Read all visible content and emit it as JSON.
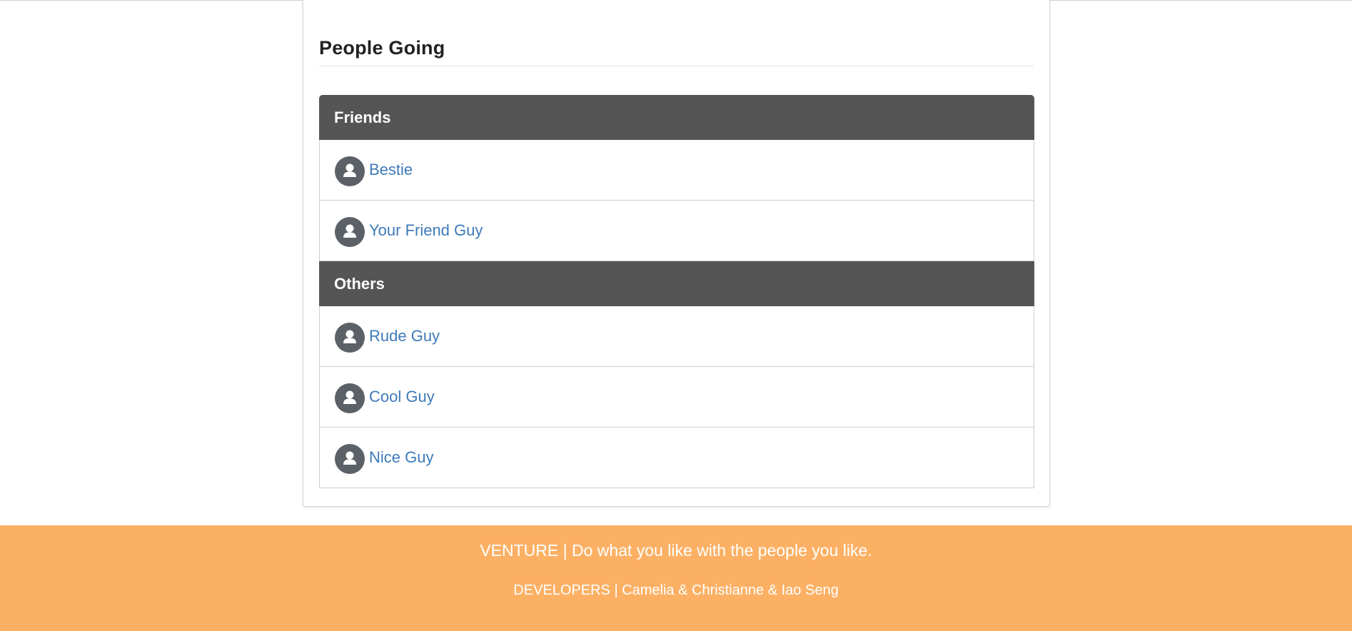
{
  "section": {
    "title": "People Going"
  },
  "groups": [
    {
      "label": "Friends",
      "people": [
        {
          "name": "Bestie"
        },
        {
          "name": "Your Friend Guy"
        }
      ]
    },
    {
      "label": "Others",
      "people": [
        {
          "name": "Rude Guy"
        },
        {
          "name": "Cool Guy"
        },
        {
          "name": "Nice Guy"
        }
      ]
    }
  ],
  "footer": {
    "tagline": "VENTURE | Do what you like with the people you like.",
    "developers": "DEVELOPERS | Camelia & Christianne & Iao Seng"
  },
  "colors": {
    "group_header_bg": "#555555",
    "link": "#3d7ab8",
    "footer_bg": "#fcb064",
    "avatar_bg": "#5b6167"
  },
  "icons": {
    "avatar": "user-silhouette-icon"
  }
}
